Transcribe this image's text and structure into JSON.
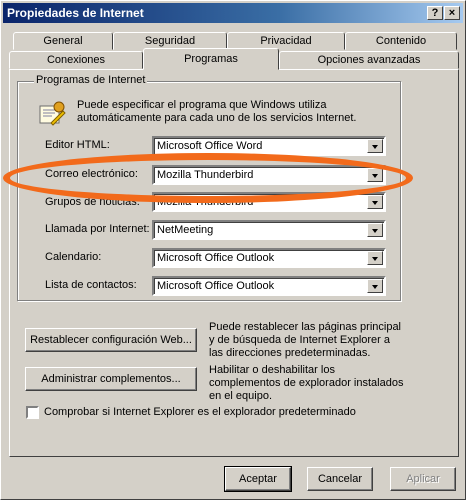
{
  "window": {
    "title": "Propiedades de Internet",
    "help_label": "?",
    "close_label": "×"
  },
  "tabs_top": [
    {
      "label": "General"
    },
    {
      "label": "Seguridad"
    },
    {
      "label": "Privacidad"
    },
    {
      "label": "Contenido"
    }
  ],
  "tabs_bottom": [
    {
      "label": "Conexiones"
    },
    {
      "label": "Programas",
      "active": true
    },
    {
      "label": "Opciones avanzadas"
    }
  ],
  "group": {
    "label": "Programas de Internet",
    "info": "Puede especificar el programa que Windows utiliza automáticamente para cada uno de los servicios Internet.",
    "icon": "programs-icon"
  },
  "rows": [
    {
      "label": "Editor HTML:",
      "value": "Microsoft Office Word"
    },
    {
      "label": "Correo electrónico:",
      "value": "Mozilla Thunderbird"
    },
    {
      "label": "Grupos de noticias:",
      "value": "Mozilla Thunderbird"
    },
    {
      "label": "Llamada por Internet:",
      "value": "NetMeeting"
    },
    {
      "label": "Calendario:",
      "value": "Microsoft Office Outlook"
    },
    {
      "label": "Lista de contactos:",
      "value": "Microsoft Office Outlook"
    }
  ],
  "actions": {
    "reset_label": "Restablecer configuración Web...",
    "reset_desc": "Puede restablecer las páginas principal y de búsqueda de Internet Explorer a las direcciones predeterminadas.",
    "addons_label": "Administrar complementos...",
    "addons_desc": "Habilitar o deshabilitar los complementos de explorador instalados en el equipo."
  },
  "checkbox": {
    "label": "Comprobar si Internet Explorer es el explorador predeterminado",
    "checked": false
  },
  "footer": {
    "ok": "Aceptar",
    "cancel": "Cancelar",
    "apply": "Aplicar"
  },
  "annotation": {
    "shape": "ellipse",
    "color": "#f26a1b",
    "target": "Correo electrónico"
  }
}
